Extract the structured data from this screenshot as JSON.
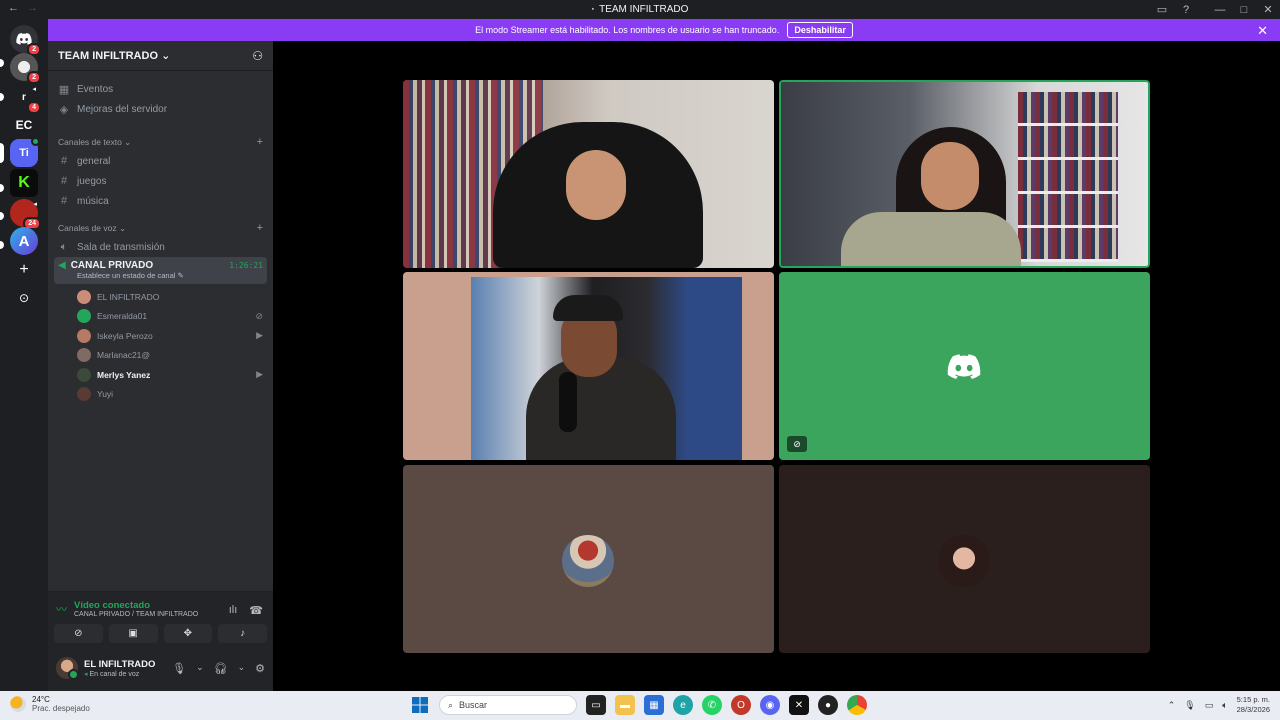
{
  "window": {
    "title": "TEAM INFILTRADO",
    "back_glyph": "←",
    "fwd_glyph": "→"
  },
  "banner": {
    "text": "El modo Streamer está habilitado. Los nombres de usuario se han truncado.",
    "button": "Deshabilitar"
  },
  "rail": {
    "servers": [
      {
        "label": "",
        "icon": "discord-home-icon",
        "badge": "2"
      },
      {
        "label": "",
        "icon": "server-avatar-icon",
        "badge": "2"
      },
      {
        "label": "r",
        "icon": "server-icon",
        "badge": "4"
      },
      {
        "label": "EC",
        "icon": "server-icon",
        "badge": ""
      },
      {
        "label": "Ti",
        "icon": "server-icon",
        "badge": ""
      },
      {
        "label": "",
        "icon": "server-icon",
        "badge": ""
      },
      {
        "label": "",
        "icon": "server-icon",
        "badge": "24"
      },
      {
        "label": "A",
        "icon": "server-icon",
        "badge": ""
      }
    ]
  },
  "guild": {
    "name": "TEAM INFILTRADO",
    "top_items": [
      {
        "label": "Eventos",
        "icon": "calendar-icon"
      },
      {
        "label": "Mejoras del servidor",
        "icon": "boost-icon"
      }
    ],
    "text_category": "Canales de texto",
    "text_channels": [
      "general",
      "juegos",
      "música"
    ],
    "voice_category": "Canales de voz",
    "voice_channels": [
      "Sala de transmisión"
    ],
    "active_voice": {
      "name": "CANAL PRIVADO",
      "timer": "1:26:21",
      "status_hint": "Establece un estado de canal"
    },
    "members": [
      {
        "name": "EL INFILTRADO",
        "right": "",
        "avatar": "#c98d7a",
        "bold": false
      },
      {
        "name": "Esmeralda01",
        "right": "mic-off",
        "avatar": "#23a55a",
        "bold": false
      },
      {
        "name": "Iskeyla Perozo",
        "right": "video",
        "avatar": "#b47a63",
        "bold": false
      },
      {
        "name": "Marlanac21@",
        "right": "",
        "avatar": "#7d6b64",
        "bold": false
      },
      {
        "name": "Merlys Yanez",
        "right": "video",
        "avatar": "#3c4a3a",
        "bold": true
      },
      {
        "name": "Yuyi",
        "right": "",
        "avatar": "#5a3b33",
        "bold": false
      }
    ]
  },
  "rtc": {
    "status": "Vídeo conectado",
    "location": "CANAL PRIVADO / TEAM INFILTRADO"
  },
  "user": {
    "name": "EL INFILTRADO",
    "status": "En canal de voz"
  },
  "colors": {
    "accent": "#8a3cf4",
    "green": "#23a55a",
    "discord_green_tile": "#3ba55d"
  },
  "taskbar": {
    "weather_temp": "24°C",
    "weather_desc": "Prac. despejado",
    "search_placeholder": "Buscar",
    "time": "5:15 p. m.",
    "date": "28/3/2026"
  }
}
